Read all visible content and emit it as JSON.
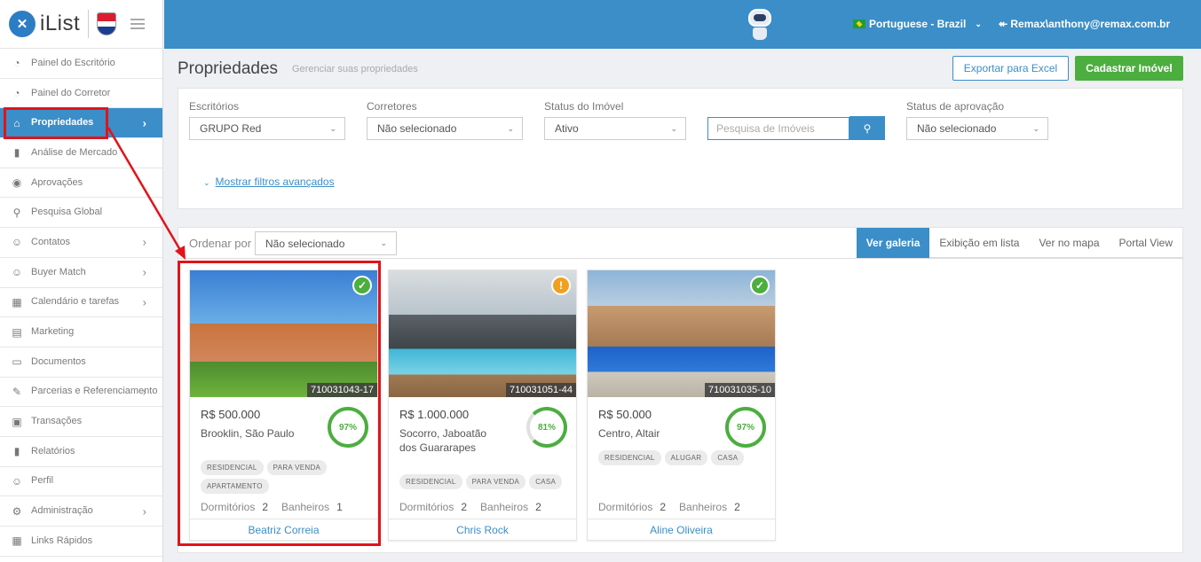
{
  "brand": {
    "logo_text": "iList",
    "logo_mark": "✕"
  },
  "sidebar": {
    "items": [
      {
        "label": "Painel do Escritório",
        "icon": "gauge-icon"
      },
      {
        "label": "Painel do Corretor",
        "icon": "gauge-icon"
      },
      {
        "label": "Propriedades",
        "icon": "home-icon",
        "active": true
      },
      {
        "label": "Análise de Mercado",
        "icon": "bar-chart-icon"
      },
      {
        "label": "Aprovações",
        "icon": "eye-icon"
      },
      {
        "label": "Pesquisa Global",
        "icon": "search-icon"
      },
      {
        "label": "Contatos",
        "icon": "contacts-icon"
      },
      {
        "label": "Buyer Match",
        "icon": "user-icon"
      },
      {
        "label": "Calendário e tarefas",
        "icon": "calendar-icon"
      },
      {
        "label": "Marketing",
        "icon": "newspaper-icon"
      },
      {
        "label": "Documentos",
        "icon": "folder-icon"
      },
      {
        "label": "Parcerias e Referenciamento",
        "icon": "handshake-icon"
      },
      {
        "label": "Transações",
        "icon": "briefcase-icon"
      },
      {
        "label": "Relatórios",
        "icon": "bar-chart-icon"
      },
      {
        "label": "Perfil",
        "icon": "user-icon"
      },
      {
        "label": "Administração",
        "icon": "gear-icon"
      },
      {
        "label": "Links Rápidos",
        "icon": "grid-icon"
      }
    ]
  },
  "topbar": {
    "language": "Portuguese - Brazil",
    "user": "Remax\\anthony@remax.com.br"
  },
  "header": {
    "title": "Propriedades",
    "subtitle": "Gerenciar suas propriedades",
    "export_label": "Exportar para Excel",
    "add_label": "Cadastrar Imóvel"
  },
  "filters": {
    "offices_label": "Escritórios",
    "offices_value": "GRUPO Red",
    "brokers_label": "Corretores",
    "brokers_value": "Não selecionado",
    "status_label": "Status do Imóvel",
    "status_value": "Ativo",
    "search_placeholder": "Pesquisa de Imóveis",
    "approval_label": "Status de aprovação",
    "approval_value": "Não selecionado",
    "advanced_link": "Mostrar filtros avançados"
  },
  "results": {
    "sort_label": "Ordenar por",
    "sort_value": "Não selecionado",
    "tabs": [
      "Ver galeria",
      "Exibição em lista",
      "Ver no mapa",
      "Portal View"
    ],
    "bedrooms_label": "Dormitórios",
    "bathrooms_label": "Banheiros"
  },
  "cards": [
    {
      "ref": "710031043-17",
      "price": "R$ 500.000",
      "location": "Brooklin, São Paulo",
      "score": "97%",
      "status": "approved",
      "tags": [
        "RESIDENCIAL",
        "PARA VENDA",
        "APARTAMENTO"
      ],
      "bedrooms": "2",
      "bathrooms": "1",
      "agent": "Beatriz Correia"
    },
    {
      "ref": "710031051-44",
      "price": "R$ 1.000.000",
      "location": "Socorro, Jaboatão dos Guararapes",
      "score": "81%",
      "status": "warning",
      "tags": [
        "RESIDENCIAL",
        "PARA VENDA",
        "CASA"
      ],
      "bedrooms": "2",
      "bathrooms": "2",
      "agent": "Chris Rock"
    },
    {
      "ref": "710031035-10",
      "price": "R$ 50.000",
      "location": "Centro, Altair",
      "score": "97%",
      "status": "approved",
      "tags": [
        "RESIDENCIAL",
        "ALUGAR",
        "CASA"
      ],
      "bedrooms": "2",
      "bathrooms": "2",
      "agent": "Aline Oliveira"
    }
  ],
  "colors": {
    "primary": "#3b8ec8",
    "success": "#4cae3f",
    "warning": "#f0a020",
    "annotation": "#e0141a"
  }
}
